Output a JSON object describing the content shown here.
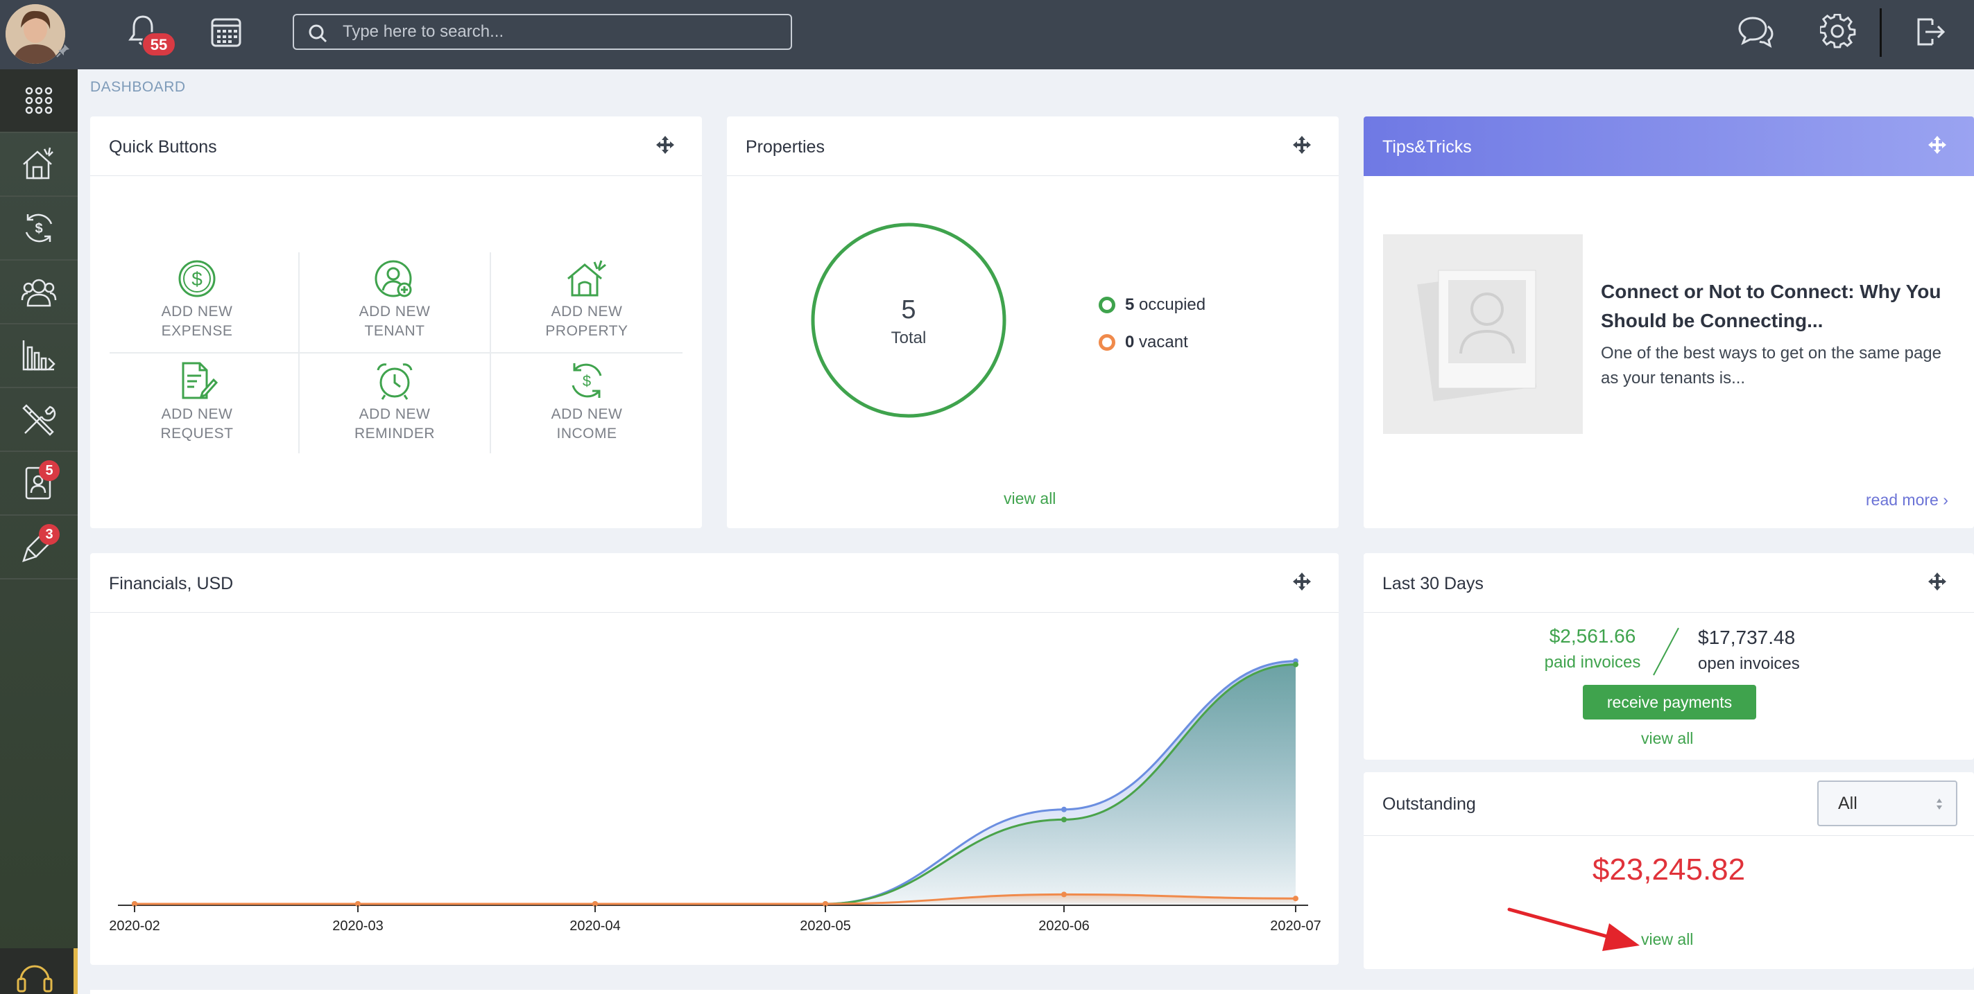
{
  "topbar": {
    "notifications_count": "55",
    "search_placeholder": "Type here to search..."
  },
  "sidebar": {
    "requests_badge": "5",
    "tools_badge": "3"
  },
  "breadcrumb": "DASHBOARD",
  "quick_buttons": {
    "title": "Quick Buttons",
    "items": [
      {
        "line1": "ADD NEW",
        "line2": "EXPENSE",
        "icon": "dollar-circle-icon"
      },
      {
        "line1": "ADD NEW",
        "line2": "TENANT",
        "icon": "user-add-icon"
      },
      {
        "line1": "ADD NEW",
        "line2": "PROPERTY",
        "icon": "house-icon"
      },
      {
        "line1": "ADD NEW",
        "line2": "REQUEST",
        "icon": "document-edit-icon"
      },
      {
        "line1": "ADD NEW",
        "line2": "REMINDER",
        "icon": "alarm-clock-icon"
      },
      {
        "line1": "ADD NEW",
        "line2": "INCOME",
        "icon": "money-cycle-icon"
      }
    ]
  },
  "properties": {
    "title": "Properties",
    "total": "5",
    "total_label": "Total",
    "occupied_count": "5",
    "occupied_label": "occupied",
    "vacant_count": "0",
    "vacant_label": "vacant",
    "view_all": "view all",
    "colors": {
      "occupied": "#3fa34d",
      "vacant": "#f08a4b"
    }
  },
  "tips": {
    "title": "Tips&Tricks",
    "headline": "Connect or Not to Connect: Why You Should be Connecting...",
    "body": "One of the best ways to get on the same page as your tenants is...",
    "read_more": "read more"
  },
  "financials": {
    "title": "Financials, USD"
  },
  "chart_data": {
    "type": "area",
    "categories": [
      "2020-02",
      "2020-03",
      "2020-04",
      "2020-05",
      "2020-06",
      "2020-07"
    ],
    "series": [
      {
        "values": [
          0,
          0,
          0,
          0,
          1400,
          3600
        ],
        "color": "#6b8ee0"
      },
      {
        "values": [
          0,
          0,
          0,
          0,
          1250,
          3550
        ],
        "color": "#4aa34a"
      },
      {
        "values": [
          0,
          0,
          0,
          0,
          140,
          80
        ],
        "color": "#f08a4b"
      }
    ],
    "xlabel": "",
    "ylabel": "",
    "ylim": [
      0,
      3700
    ],
    "grid": false
  },
  "last30": {
    "title": "Last 30 Days",
    "paid_amount": "$2,561.66",
    "paid_label": "paid invoices",
    "open_amount": "$17,737.48",
    "open_label": "open invoices",
    "receive_button": "receive payments",
    "view_all": "view all"
  },
  "outstanding": {
    "title": "Outstanding",
    "filter_value": "All",
    "amount": "$23,245.82",
    "view_all": "view all",
    "amount_color": "#e0323a"
  }
}
